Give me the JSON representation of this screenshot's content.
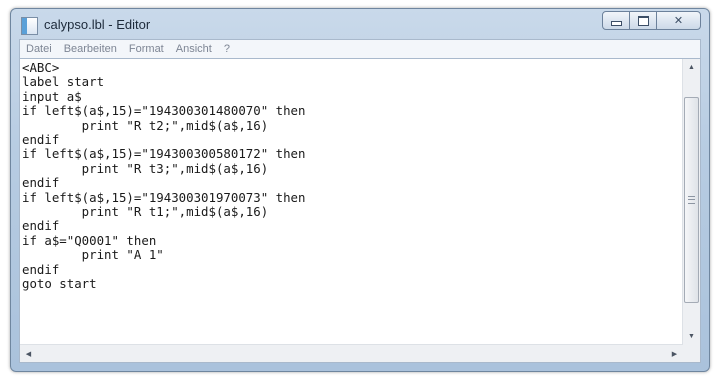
{
  "window": {
    "title": "calypso.lbl - Editor"
  },
  "menu": [
    "Datei",
    "Bearbeiten",
    "Format",
    "Ansicht",
    "?"
  ],
  "editor": {
    "content": "<ABC>\nlabel start\ninput a$\nif left$(a$,15)=\"194300301480070\" then\n        print \"R t2;\",mid$(a$,16)\nendif\nif left$(a$,15)=\"194300300580172\" then\n        print \"R t3;\",mid$(a$,16)\nendif\nif left$(a$,15)=\"194300301970073\" then\n        print \"R t1;\",mid$(a$,16)\nendif\nif a$=\"Q0001\" then\n        print \"A 1\"\nendif\ngoto start"
  },
  "icons": {
    "app": "notepad-icon",
    "minimize": "minimize-icon",
    "maximize": "maximize-icon",
    "close": "close-icon",
    "scroll_up": "arrow-up-icon",
    "scroll_down": "arrow-down-icon",
    "scroll_left": "arrow-left-icon",
    "scroll_right": "arrow-right-icon"
  }
}
